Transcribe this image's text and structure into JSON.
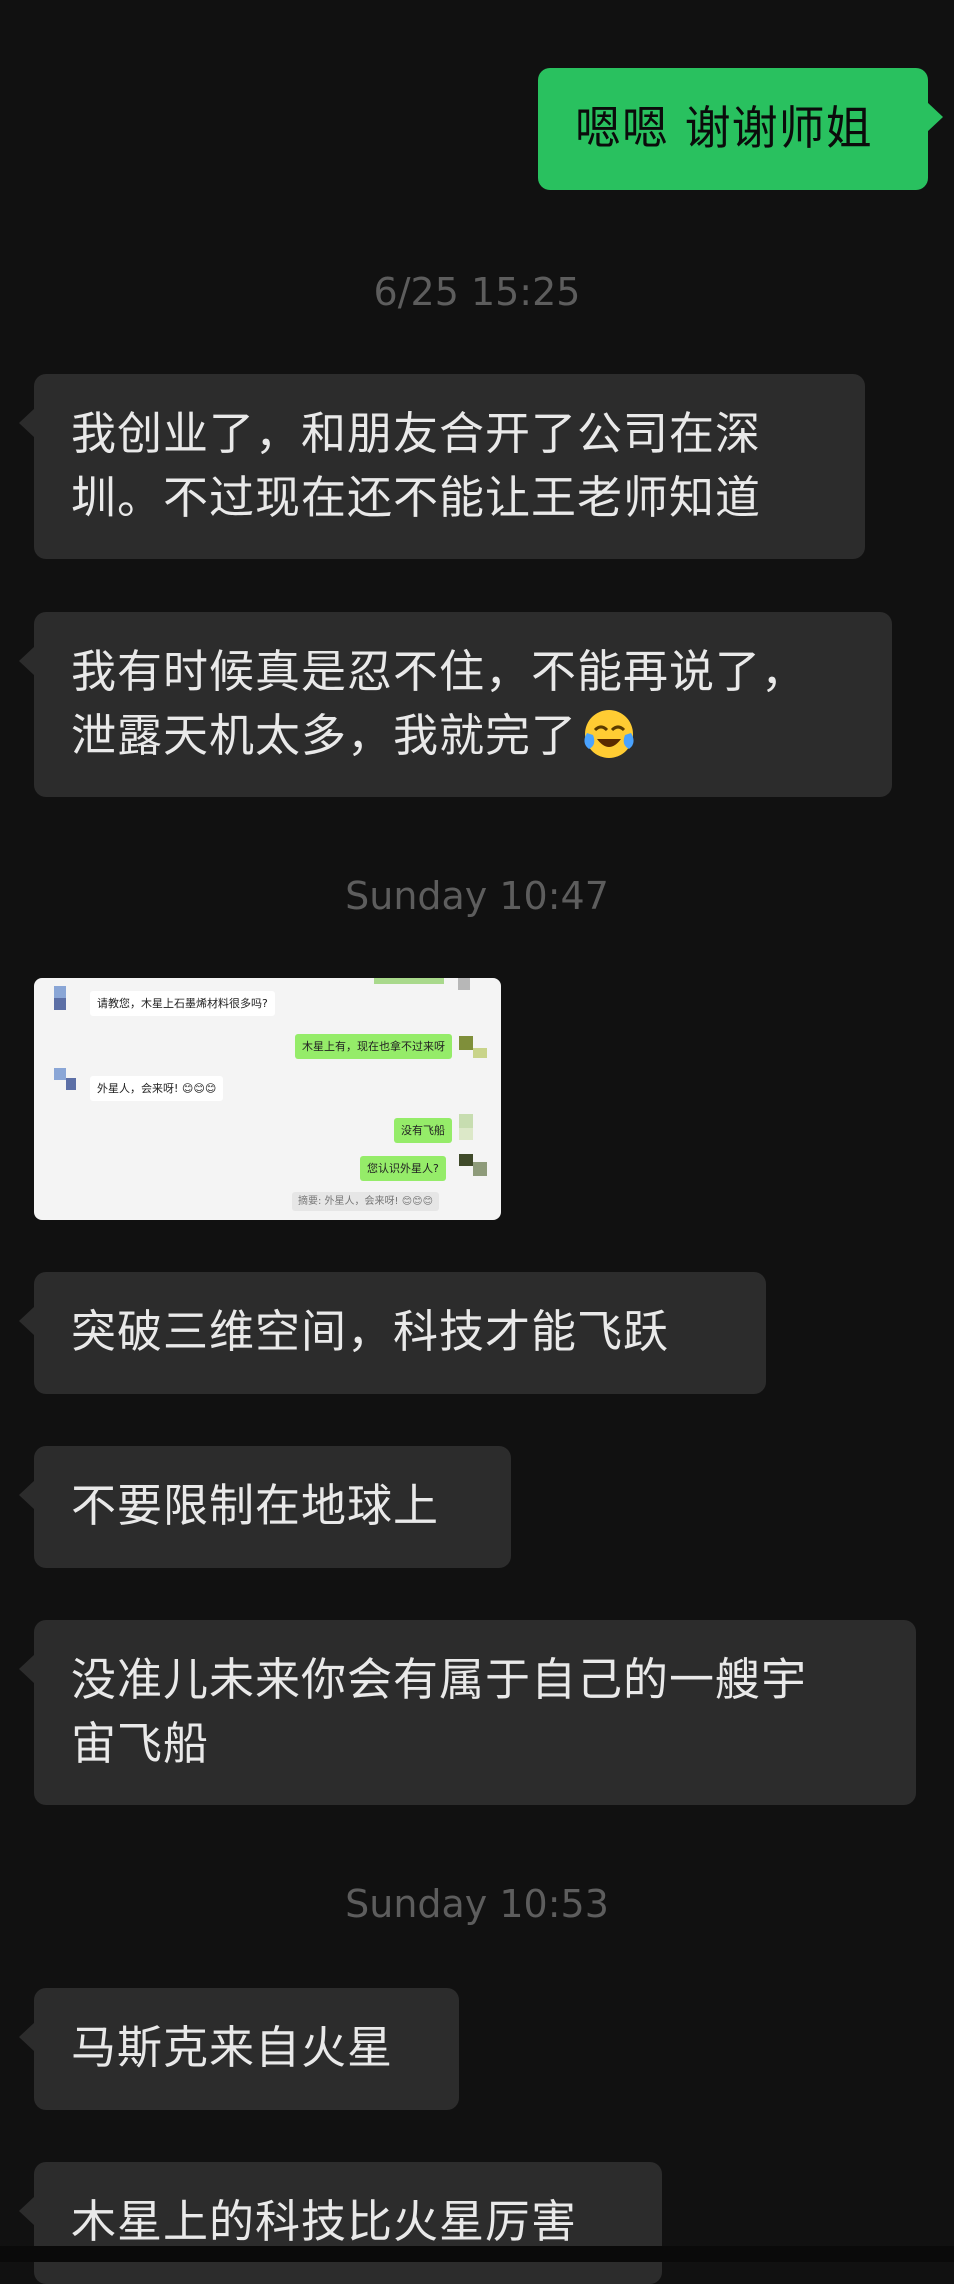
{
  "messages": {
    "m1": "嗯嗯 谢谢师姐",
    "ts1": "6/25 15:25",
    "m2_l1": "我创业了，和朋友合开了公司在深",
    "m2_l2": "圳。不过现在还不能让王老师知道",
    "m3_l1": "我有时候真是忍不住，不能再说了，",
    "m3_l2": "泄露天机太多，我就完了",
    "ts2": "Sunday 10:47",
    "m4": "突破三维空间，科技才能飞跃",
    "m5": "不要限制在地球上",
    "m6_l1": "没准儿未来你会有属于自己的一艘宇",
    "m6_l2": "宙飞船",
    "ts3": "Sunday 10:53",
    "m7": "马斯克来自火星",
    "m8": "木星上的科技比火星厉害"
  },
  "screenshot": {
    "q1": "请教您，木星上石墨烯材料很多吗?",
    "a1": "木星上有，现在也拿不过来呀",
    "q2": "外星人，会来呀! 😊😊😊",
    "a2": "没有飞船",
    "a3": "您认识外星人?",
    "quote": "摘要: 外星人，会来呀! 😊😊😊"
  },
  "icons": {
    "emoji": "crying-laughing-emoji"
  },
  "colors": {
    "background": "#111111",
    "incoming_bubble": "#2c2c2c",
    "outgoing_bubble": "#29c15f",
    "timestamp": "#5d5d5d"
  }
}
